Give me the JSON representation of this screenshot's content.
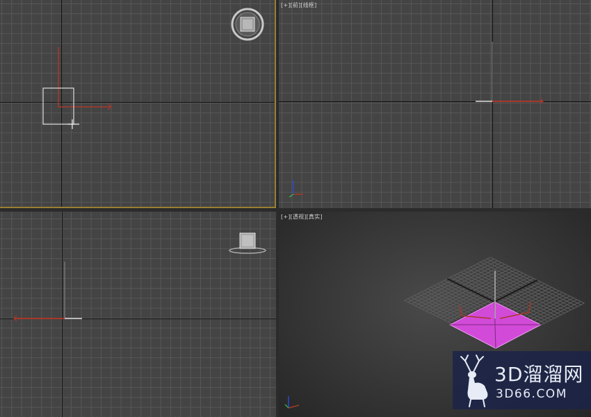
{
  "viewports": {
    "top": {
      "label_parts": []
    },
    "front": {
      "label_parts": [
        "[+]",
        "[前]",
        "[线框]"
      ]
    },
    "left": {
      "label_parts": []
    },
    "perspective": {
      "label_parts": [
        "[+]",
        "[透视]",
        "[真实]"
      ]
    }
  },
  "icons": {
    "top_viewcube": "viewcube-icon",
    "left_viewcube": "viewcube-icon",
    "transform_gizmo": "move-gizmo-icon",
    "axis_tripod": "axis-tripod-icon"
  },
  "colors": {
    "active_viewport_border": "#9a8030",
    "selected_plane": "#d24ad8",
    "gizmo_x_axis": "#a8382a",
    "gizmo_z_axis": "#2a4ad0",
    "gizmo_y_axis": "#3aa84a"
  },
  "watermark": {
    "name": "3D溜溜网",
    "url": "3D66.COM"
  }
}
